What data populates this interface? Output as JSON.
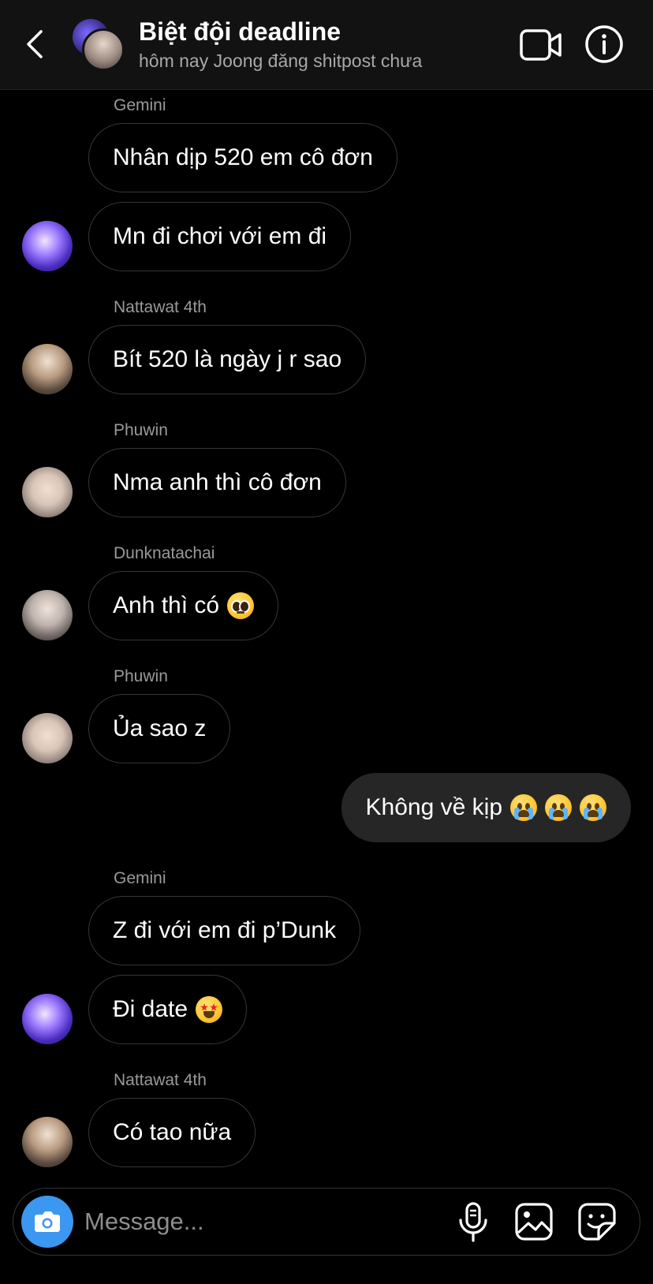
{
  "header": {
    "title": "Biệt đội deadline",
    "subtitle": "hôm nay Joong đăng shitpost chưa"
  },
  "messages": [
    {
      "sender": "Gemini",
      "text": "Nhân dịp 520 em cô đơn"
    },
    {
      "text": "Mn đi chơi với em đi"
    },
    {
      "sender": "Nattawat 4th",
      "text": "Bít 520 là ngày j r sao"
    },
    {
      "sender": "Phuwin",
      "text": "Nma anh thì cô đơn"
    },
    {
      "sender": "Dunknatachai",
      "text": "Anh thì có",
      "emoji": "pleading-face"
    },
    {
      "sender": "Phuwin",
      "text": "Ủa sao z"
    },
    {
      "text": "Không về kịp",
      "emoji": "loudly-crying-face x3",
      "outgoing": true
    },
    {
      "sender": "Gemini",
      "text": "Z đi với em đi p’Dunk"
    },
    {
      "text": "Đi date",
      "emoji": "star-struck-face"
    },
    {
      "sender": "Nattawat 4th",
      "text": "Có tao nữa"
    }
  ],
  "composer": {
    "placeholder": "Message..."
  },
  "icons": [
    "back-icon",
    "video-call-icon",
    "info-icon",
    "camera-icon",
    "microphone-icon",
    "gallery-icon",
    "sticker-icon"
  ],
  "colors": {
    "background": "#000000",
    "header": "#121212",
    "outgoing_bubble": "#262626",
    "camera_button": "#3b97f0"
  }
}
